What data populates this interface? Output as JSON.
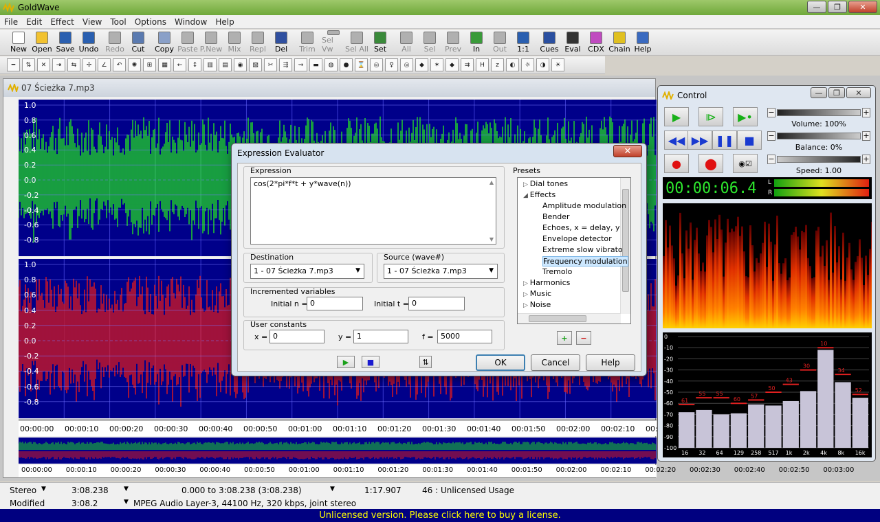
{
  "app": {
    "title": "GoldWave"
  },
  "menu": [
    "File",
    "Edit",
    "Effect",
    "View",
    "Tool",
    "Options",
    "Window",
    "Help"
  ],
  "toolbar": [
    {
      "label": "New",
      "enabled": true,
      "color": "#ffffff"
    },
    {
      "label": "Open",
      "enabled": true,
      "color": "#f2c230"
    },
    {
      "label": "Save",
      "enabled": true,
      "color": "#2a5fb0"
    },
    {
      "label": "Undo",
      "enabled": true,
      "color": "#2a5fb0"
    },
    {
      "label": "Redo",
      "enabled": false,
      "color": "#b0b0b0"
    },
    {
      "label": "Cut",
      "enabled": true,
      "color": "#5a7ab0"
    },
    {
      "label": "Copy",
      "enabled": true,
      "color": "#8aa0c8"
    },
    {
      "label": "Paste",
      "enabled": false,
      "color": "#b0b0b0"
    },
    {
      "label": "P.New",
      "enabled": false,
      "color": "#b0b0b0"
    },
    {
      "label": "Mix",
      "enabled": false,
      "color": "#b0b0b0"
    },
    {
      "label": "Repl",
      "enabled": false,
      "color": "#b0b0b0"
    },
    {
      "label": "Del",
      "enabled": true,
      "color": "#3050a0"
    },
    {
      "label": "Trim",
      "enabled": false,
      "color": "#b0b0b0"
    },
    {
      "label": "Sel Vw",
      "enabled": false,
      "color": "#b0b0b0"
    },
    {
      "label": "Sel All",
      "enabled": false,
      "color": "#b0b0b0"
    },
    {
      "label": "Set",
      "enabled": true,
      "color": "#3a8a3a"
    },
    {
      "label": "All",
      "enabled": false,
      "color": "#b0b0b0"
    },
    {
      "label": "Sel",
      "enabled": false,
      "color": "#b0b0b0"
    },
    {
      "label": "Prev",
      "enabled": false,
      "color": "#b0b0b0"
    },
    {
      "label": "In",
      "enabled": true,
      "color": "#3a9a3a"
    },
    {
      "label": "Out",
      "enabled": false,
      "color": "#b0b0b0"
    },
    {
      "label": "1:1",
      "enabled": true,
      "color": "#2a5fb0"
    },
    {
      "label": "Cues",
      "enabled": true,
      "color": "#2a4fa0"
    },
    {
      "label": "Eval",
      "enabled": true,
      "color": "#333333"
    },
    {
      "label": "CDX",
      "enabled": true,
      "color": "#c04ac0"
    },
    {
      "label": "Chain",
      "enabled": true,
      "color": "#e0c020"
    },
    {
      "label": "Help",
      "enabled": true,
      "color": "#3a6ac0"
    }
  ],
  "wave_window": {
    "title": "07 Ścieżka 7.mp3",
    "y_labels_top": [
      "1.0",
      "0.8",
      "0.6",
      "0.4",
      "0.2",
      "0.0",
      "-0.2",
      "-0.4",
      "-0.6",
      "-0.8"
    ],
    "y_labels_bot": [
      "1.0",
      "0.8",
      "0.6",
      "0.4",
      "0.2",
      "0.0",
      "-0.2",
      "-0.4",
      "-0.6",
      "-0.8"
    ],
    "timeline": [
      "00:00:00",
      "00:00:10",
      "00:00:20",
      "00:00:30",
      "00:00:40",
      "00:00:50",
      "00:01:00",
      "00:01:10",
      "00:01:20",
      "00:01:30",
      "00:01:40",
      "00:01:50",
      "00:02:00",
      "00:02:10",
      "00:02:20"
    ],
    "timeline2": [
      "00:00:00",
      "00:00:10",
      "00:00:20",
      "00:00:30",
      "00:00:40",
      "00:00:50",
      "00:01:00",
      "00:01:10",
      "00:01:20",
      "00:01:30",
      "00:01:40",
      "00:01:50",
      "00:02:00",
      "00:02:10",
      "00:02:20",
      "00:02:30",
      "00:02:40",
      "00:02:50",
      "00:03:00"
    ],
    "left_color": "#22e022",
    "right_color": "#e41a1a",
    "bg_color": "#00008a"
  },
  "dialog": {
    "title": "Expression Evaluator",
    "close": "✕",
    "expression_label": "Expression",
    "expression": "cos(2*pi*f*t + y*wave(n))",
    "presets_label": "Presets",
    "destination_label": "Destination",
    "destination": "1 - 07 Ścieżka 7.mp3",
    "source_label": "Source (wave#)",
    "source": "1 - 07 Ścieżka 7.mp3",
    "incremented_label": "Incremented variables",
    "initial_n_label": "Initial n =",
    "initial_n": "0",
    "initial_t_label": "Initial t =",
    "initial_t": "0",
    "user_constants_label": "User constants",
    "x_label": "x =",
    "x": "0",
    "y_label": "y =",
    "y": "1",
    "f_label": "f =",
    "f": "5000",
    "presets": [
      {
        "label": "Dial tones",
        "indent": 0,
        "expander": "▷"
      },
      {
        "label": "Effects",
        "indent": 0,
        "expander": "◢"
      },
      {
        "label": "Amplitude modulation",
        "indent": 1,
        "expander": ""
      },
      {
        "label": "Bender",
        "indent": 1,
        "expander": ""
      },
      {
        "label": "Echoes, x = delay, y",
        "indent": 1,
        "expander": ""
      },
      {
        "label": "Envelope detector",
        "indent": 1,
        "expander": ""
      },
      {
        "label": "Extreme slow vibrato",
        "indent": 1,
        "expander": ""
      },
      {
        "label": "Frequency modulation",
        "indent": 1,
        "expander": "",
        "selected": true
      },
      {
        "label": "Tremolo",
        "indent": 1,
        "expander": ""
      },
      {
        "label": "Harmonics",
        "indent": 0,
        "expander": "▷"
      },
      {
        "label": "Music",
        "indent": 0,
        "expander": "▷"
      },
      {
        "label": "Noise",
        "indent": 0,
        "expander": "▷"
      }
    ],
    "add_glyph": "+",
    "remove_glyph": "−",
    "play_glyph": "▶",
    "stop_glyph": "■",
    "ok": "OK",
    "cancel": "Cancel",
    "help": "Help"
  },
  "control": {
    "title": "Control",
    "volume": "Volume: 100%",
    "balance": "Balance: 0%",
    "speed": "Speed: 1.00",
    "time": "00:00:06.4",
    "l": "L",
    "r": "R",
    "bar_values": [
      -61,
      -55,
      -55,
      -60,
      -57,
      -50,
      -43,
      -30,
      -10,
      -34,
      -52
    ],
    "bar_heights": [
      -68,
      -66,
      -70,
      -69,
      -61,
      -62,
      -58,
      -49,
      -12,
      -41,
      -55
    ],
    "bar_labels": [
      "16",
      "32",
      "64",
      "129",
      "258",
      "517",
      "1k",
      "2k",
      "4k",
      "8k",
      "16k"
    ],
    "y_ticks": [
      "0",
      "-10",
      "-20",
      "-30",
      "-40",
      "-50",
      "-60",
      "-70",
      "-80",
      "-90",
      "-100"
    ]
  },
  "status": {
    "channels": "Stereo",
    "length": "3:08.238",
    "selection": "0.000 to 3:08.238 (3:08.238)",
    "position": "1:17.907",
    "usage": "46 : Unlicensed Usage",
    "state": "Modified",
    "length2": "3:08.2",
    "format": "MPEG Audio Layer-3, 44100 Hz, 320 kbps, joint stereo"
  },
  "license": "Unlicensed version. Please click here to buy a license."
}
